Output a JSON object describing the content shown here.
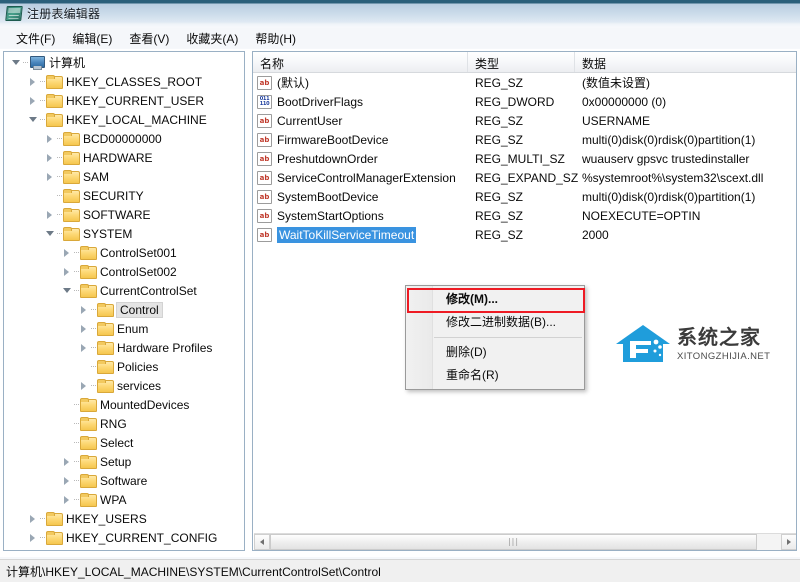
{
  "window": {
    "title": "注册表编辑器",
    "icon": "regedit-icon"
  },
  "menubar": {
    "items": [
      {
        "label": "文件(F)"
      },
      {
        "label": "编辑(E)"
      },
      {
        "label": "查看(V)"
      },
      {
        "label": "收藏夹(A)"
      },
      {
        "label": "帮助(H)"
      }
    ]
  },
  "tree": {
    "root": {
      "label": "计算机",
      "depth": 0,
      "state": "expanded",
      "icon": "computer-icon"
    },
    "nodes": [
      {
        "label": "HKEY_CLASSES_ROOT",
        "depth": 1,
        "state": "collapsed",
        "selected": false
      },
      {
        "label": "HKEY_CURRENT_USER",
        "depth": 1,
        "state": "collapsed",
        "selected": false
      },
      {
        "label": "HKEY_LOCAL_MACHINE",
        "depth": 1,
        "state": "expanded",
        "selected": false
      },
      {
        "label": "BCD00000000",
        "depth": 2,
        "state": "collapsed",
        "selected": false
      },
      {
        "label": "HARDWARE",
        "depth": 2,
        "state": "collapsed",
        "selected": false
      },
      {
        "label": "SAM",
        "depth": 2,
        "state": "collapsed",
        "selected": false
      },
      {
        "label": "SECURITY",
        "depth": 2,
        "state": "leaf",
        "selected": false
      },
      {
        "label": "SOFTWARE",
        "depth": 2,
        "state": "collapsed",
        "selected": false
      },
      {
        "label": "SYSTEM",
        "depth": 2,
        "state": "expanded",
        "selected": false
      },
      {
        "label": "ControlSet001",
        "depth": 3,
        "state": "collapsed",
        "selected": false
      },
      {
        "label": "ControlSet002",
        "depth": 3,
        "state": "collapsed",
        "selected": false
      },
      {
        "label": "CurrentControlSet",
        "depth": 3,
        "state": "expanded",
        "selected": false
      },
      {
        "label": "Control",
        "depth": 4,
        "state": "collapsed",
        "selected": true
      },
      {
        "label": "Enum",
        "depth": 4,
        "state": "collapsed",
        "selected": false
      },
      {
        "label": "Hardware Profiles",
        "depth": 4,
        "state": "collapsed",
        "selected": false
      },
      {
        "label": "Policies",
        "depth": 4,
        "state": "leaf",
        "selected": false
      },
      {
        "label": "services",
        "depth": 4,
        "state": "collapsed",
        "selected": false
      },
      {
        "label": "MountedDevices",
        "depth": 3,
        "state": "leaf",
        "selected": false
      },
      {
        "label": "RNG",
        "depth": 3,
        "state": "leaf",
        "selected": false
      },
      {
        "label": "Select",
        "depth": 3,
        "state": "leaf",
        "selected": false
      },
      {
        "label": "Setup",
        "depth": 3,
        "state": "collapsed",
        "selected": false
      },
      {
        "label": "Software",
        "depth": 3,
        "state": "collapsed",
        "selected": false
      },
      {
        "label": "WPA",
        "depth": 3,
        "state": "collapsed",
        "selected": false
      },
      {
        "label": "HKEY_USERS",
        "depth": 1,
        "state": "collapsed",
        "selected": false
      },
      {
        "label": "HKEY_CURRENT_CONFIG",
        "depth": 1,
        "state": "collapsed",
        "selected": false
      }
    ]
  },
  "list": {
    "columns": [
      {
        "label": "名称"
      },
      {
        "label": "类型"
      },
      {
        "label": "数据"
      }
    ],
    "rows": [
      {
        "name": "(默认)",
        "type": "REG_SZ",
        "data": "(数值未设置)",
        "icon": "string-value-icon",
        "selected": false
      },
      {
        "name": "BootDriverFlags",
        "type": "REG_DWORD",
        "data": "0x00000000 (0)",
        "icon": "dword-value-icon",
        "selected": false
      },
      {
        "name": "CurrentUser",
        "type": "REG_SZ",
        "data": "USERNAME",
        "icon": "string-value-icon",
        "selected": false
      },
      {
        "name": "FirmwareBootDevice",
        "type": "REG_SZ",
        "data": "multi(0)disk(0)rdisk(0)partition(1)",
        "icon": "string-value-icon",
        "selected": false
      },
      {
        "name": "PreshutdownOrder",
        "type": "REG_MULTI_SZ",
        "data": "wuauserv gpsvc trustedinstaller",
        "icon": "string-value-icon",
        "selected": false
      },
      {
        "name": "ServiceControlManagerExtension",
        "type": "REG_EXPAND_SZ",
        "data": "%systemroot%\\system32\\scext.dll",
        "icon": "string-value-icon",
        "selected": false
      },
      {
        "name": "SystemBootDevice",
        "type": "REG_SZ",
        "data": "multi(0)disk(0)rdisk(0)partition(1)",
        "icon": "string-value-icon",
        "selected": false
      },
      {
        "name": "SystemStartOptions",
        "type": "REG_SZ",
        "data": " NOEXECUTE=OPTIN",
        "icon": "string-value-icon",
        "selected": false
      },
      {
        "name": "WaitToKillServiceTimeout",
        "type": "REG_SZ",
        "data": "2000",
        "icon": "string-value-icon",
        "selected": true
      }
    ]
  },
  "context_menu": {
    "items": [
      {
        "label": "修改(M)...",
        "bold": true,
        "highlighted": true
      },
      {
        "label": "修改二进制数据(B)...",
        "bold": false,
        "highlighted": false
      },
      {
        "label": "删除(D)",
        "bold": false,
        "highlighted": false
      },
      {
        "label": "重命名(R)",
        "bold": false,
        "highlighted": false
      }
    ],
    "highlight_color": "#ee1b24"
  },
  "watermark": {
    "cn_text": "系统之家",
    "en_text": "XITONGZHIJIA.NET",
    "logo_color": "#1f9ddb"
  },
  "statusbar": {
    "path": "计算机\\HKEY_LOCAL_MACHINE\\SYSTEM\\CurrentControlSet\\Control"
  },
  "scrollbar": {
    "grip": "⦀"
  }
}
